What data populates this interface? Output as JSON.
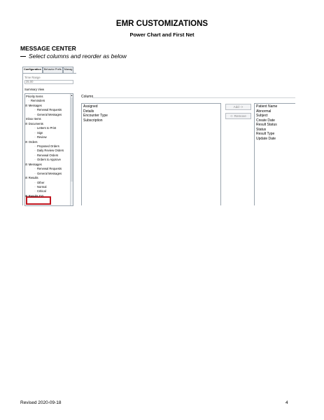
{
  "document": {
    "title": "EMR CUSTOMIZATIONS",
    "subtitle": "Power Chart and First Net",
    "section_heading": "MESSAGE CENTER",
    "instruction": "Select columns and reorder as below",
    "footer_revised": "Revised 2020-09-18",
    "page_number": "4"
  },
  "screenshot": {
    "tabs": [
      "Configuration",
      "Behavior Prefs",
      "Manag"
    ],
    "time_range_label": "Time Range",
    "time_range_value": "35.00",
    "summary_view_label": "Summary View",
    "tree": [
      {
        "label": "Priority Items",
        "level": 0,
        "toggle": ""
      },
      {
        "label": "Reminders",
        "level": 1,
        "toggle": ""
      },
      {
        "label": "Messages",
        "level": 1,
        "toggle": "⊟"
      },
      {
        "label": "Renewal Requests",
        "level": 2,
        "toggle": ""
      },
      {
        "label": "General Messages",
        "level": 2,
        "toggle": ""
      },
      {
        "label": "Inbox Items",
        "level": 0,
        "toggle": ""
      },
      {
        "label": "Documents",
        "level": 1,
        "toggle": "⊟"
      },
      {
        "label": "Letters to Print",
        "level": 2,
        "toggle": ""
      },
      {
        "label": "Sign",
        "level": 2,
        "toggle": ""
      },
      {
        "label": "Review",
        "level": 2,
        "toggle": ""
      },
      {
        "label": "Orders",
        "level": 1,
        "toggle": "⊟"
      },
      {
        "label": "Proposed Orders",
        "level": 2,
        "toggle": ""
      },
      {
        "label": "Daily Review Orders",
        "level": 2,
        "toggle": ""
      },
      {
        "label": "Renewal Orders",
        "level": 2,
        "toggle": ""
      },
      {
        "label": "Orders to Approve",
        "level": 2,
        "toggle": ""
      },
      {
        "label": "Messages",
        "level": 1,
        "toggle": "⊟"
      },
      {
        "label": "Renewal Requests",
        "level": 2,
        "toggle": ""
      },
      {
        "label": "General Messages",
        "level": 2,
        "toggle": ""
      },
      {
        "label": "Results",
        "level": 1,
        "toggle": "⊟"
      },
      {
        "label": "Other",
        "level": 2,
        "toggle": ""
      },
      {
        "label": "Normal",
        "level": 2,
        "toggle": ""
      },
      {
        "label": "Critical",
        "level": 2,
        "toggle": ""
      },
      {
        "label": "Results FYI",
        "level": 1,
        "toggle": "⊞"
      }
    ],
    "column_label": "Column",
    "available_columns": [
      "Assigned",
      "Details",
      "Encounter Type",
      "Subscription"
    ],
    "add_button": "Add ->",
    "remove_button": "<- Remove",
    "selected_columns": [
      "Patient Name",
      "Abnormal",
      "Subject",
      "Create Date",
      "Result Status",
      "Status",
      "Result Type",
      "Update Date"
    ],
    "highlight_color": "#c0151f"
  }
}
